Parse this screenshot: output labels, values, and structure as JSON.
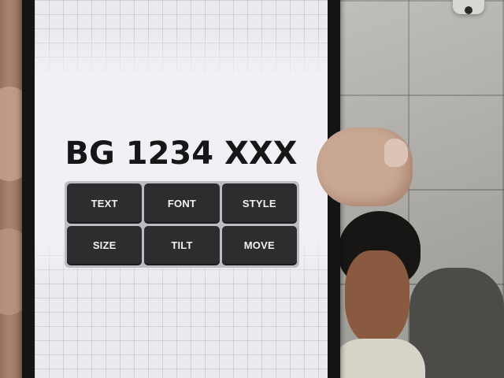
{
  "plate": {
    "text": "BG 1234 XXX"
  },
  "toolbar": {
    "buttons": [
      {
        "label": "TEXT"
      },
      {
        "label": "FONT"
      },
      {
        "label": "STYLE"
      },
      {
        "label": "SIZE"
      },
      {
        "label": "TILT"
      },
      {
        "label": "MOVE"
      }
    ]
  },
  "colors": {
    "button_bg": "#2b2d2f",
    "button_text": "#f2f2f2",
    "screen_bg": "#ece9f0",
    "plate_text": "#161616"
  }
}
